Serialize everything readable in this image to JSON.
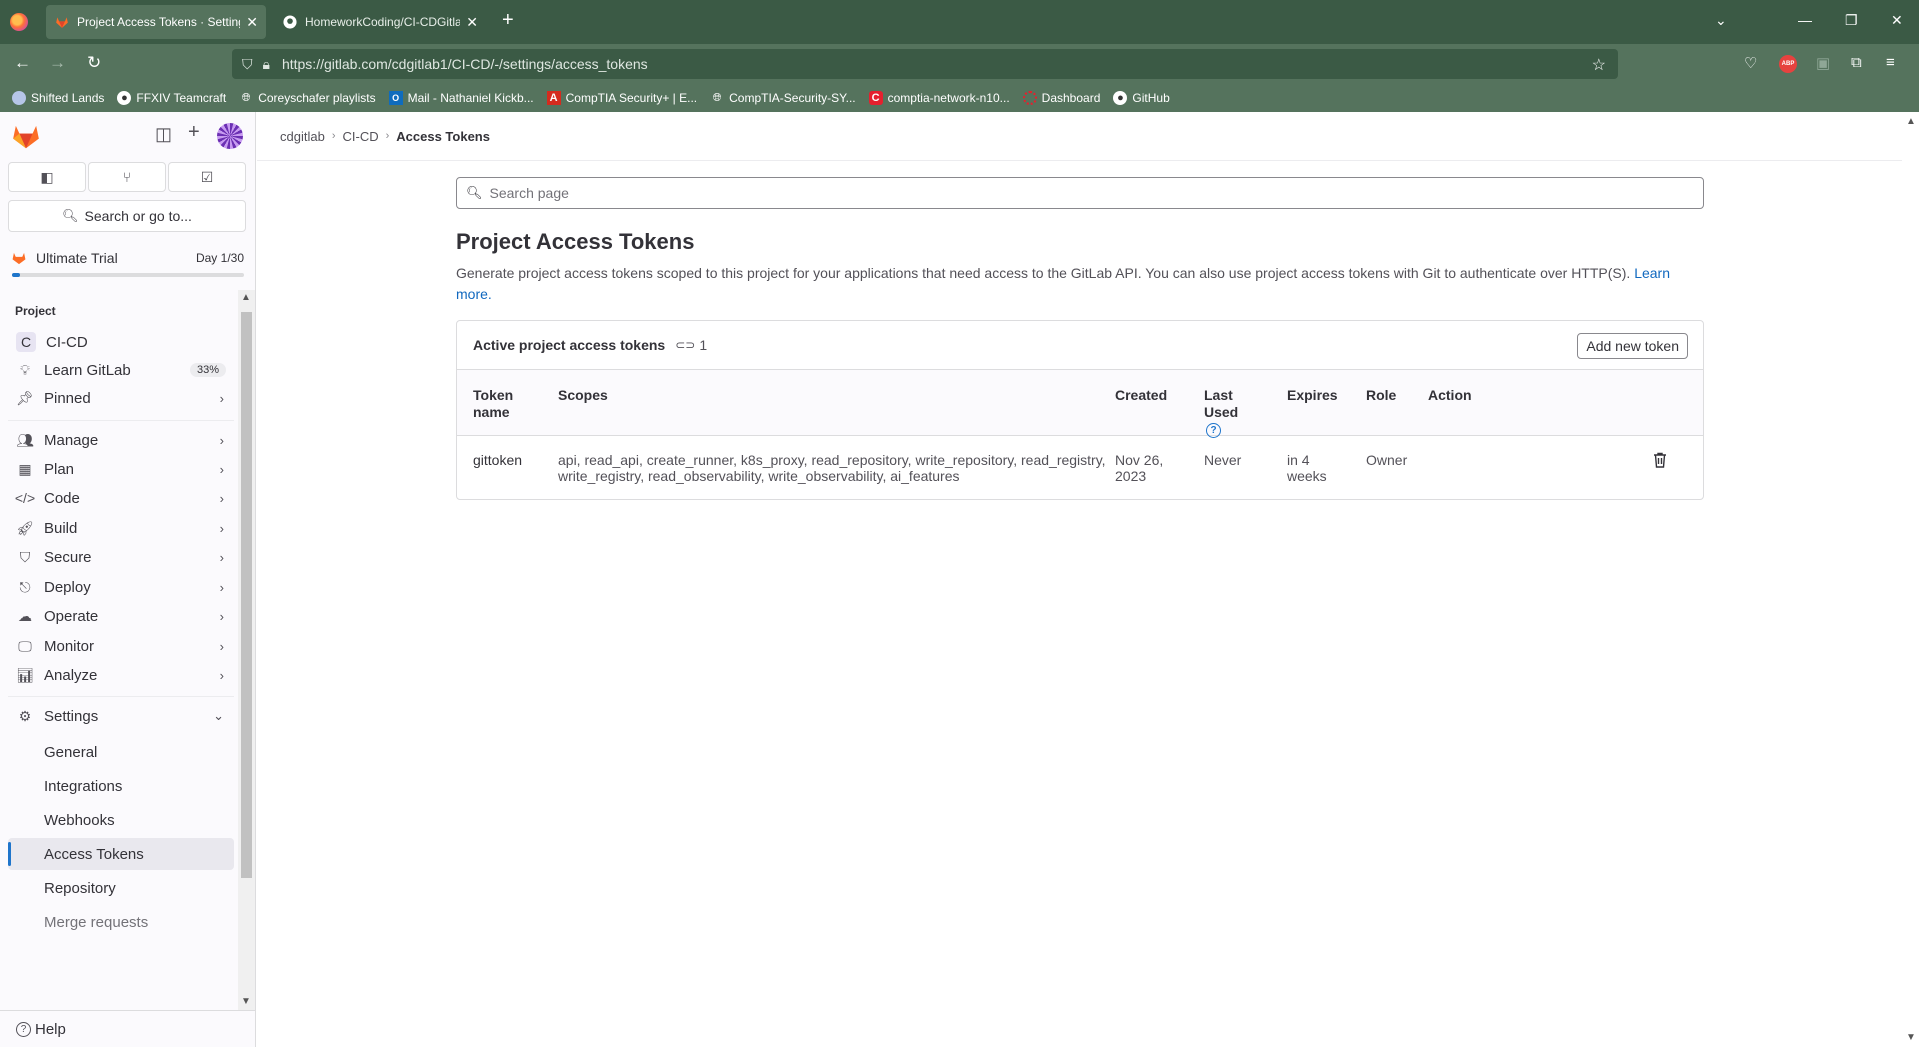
{
  "browser": {
    "tabs": [
      {
        "title": "Project Access Tokens · Settings",
        "active": true
      },
      {
        "title": "HomeworkCoding/CI-CDGitlab",
        "active": false
      }
    ],
    "url": "https://gitlab.com/cdgitlab1/CI-CD/-/settings/access_tokens",
    "bookmarks": [
      {
        "label": "Shifted Lands",
        "icon": "globe-icon"
      },
      {
        "label": "FFXIV Teamcraft",
        "icon": "teamcraft-icon"
      },
      {
        "label": "Coreyschafer playlists",
        "icon": "globe-icon"
      },
      {
        "label": "Mail - Nathaniel Kickb...",
        "icon": "outlook-icon"
      },
      {
        "label": "CompTIA Security+ | E...",
        "icon": "a-icon"
      },
      {
        "label": "CompTIA-Security-SY...",
        "icon": "globe-icon"
      },
      {
        "label": "comptia-network-n10...",
        "icon": "c-icon"
      },
      {
        "label": "Dashboard",
        "icon": "dashboard-icon"
      },
      {
        "label": "GitHub",
        "icon": "github-icon"
      }
    ],
    "abp_label": "ABP"
  },
  "sidebar": {
    "search_label": "Search or go to...",
    "trial": {
      "label": "Ultimate Trial",
      "day": "Day 1/30",
      "progress": 0.033
    },
    "section_label": "Project",
    "project": {
      "letter": "C",
      "name": "CI-CD"
    },
    "learn": {
      "label": "Learn GitLab",
      "badge": "33%"
    },
    "pinned": "Pinned",
    "items": [
      {
        "label": "Manage",
        "icon": "users-icon"
      },
      {
        "label": "Plan",
        "icon": "calendar-icon"
      },
      {
        "label": "Code",
        "icon": "code-icon"
      },
      {
        "label": "Build",
        "icon": "rocket-icon"
      },
      {
        "label": "Secure",
        "icon": "shield-icon"
      },
      {
        "label": "Deploy",
        "icon": "deploy-icon"
      },
      {
        "label": "Operate",
        "icon": "cloud-icon"
      },
      {
        "label": "Monitor",
        "icon": "monitor-icon"
      },
      {
        "label": "Analyze",
        "icon": "chart-icon"
      }
    ],
    "settings": {
      "label": "Settings",
      "sub": [
        "General",
        "Integrations",
        "Webhooks",
        "Access Tokens",
        "Repository",
        "Merge requests"
      ],
      "active": "Access Tokens"
    },
    "help": "Help"
  },
  "breadcrumb": [
    "cdgitlab",
    "CI-CD",
    "Access Tokens"
  ],
  "main": {
    "search_placeholder": "Search page",
    "title": "Project Access Tokens",
    "description": "Generate project access tokens scoped to this project for your applications that need access to the GitLab API. You can also use project access tokens with Git to authenticate over HTTP(S).",
    "learn_more": "Learn more.",
    "card": {
      "title": "Active project access tokens",
      "count": "1",
      "add_button": "Add new token",
      "headers": {
        "name": "Token name",
        "scopes": "Scopes",
        "created": "Created",
        "last_used": "Last Used",
        "expires": "Expires",
        "role": "Role",
        "action": "Action"
      },
      "rows": [
        {
          "name": "gittoken",
          "scopes": "api, read_api, create_runner, k8s_proxy, read_repository, write_repository, read_registry, write_registry, read_observability, write_observability, ai_features",
          "created": "Nov 26, 2023",
          "last_used": "Never",
          "expires": "in 4 weeks",
          "role": "Owner"
        }
      ]
    }
  }
}
